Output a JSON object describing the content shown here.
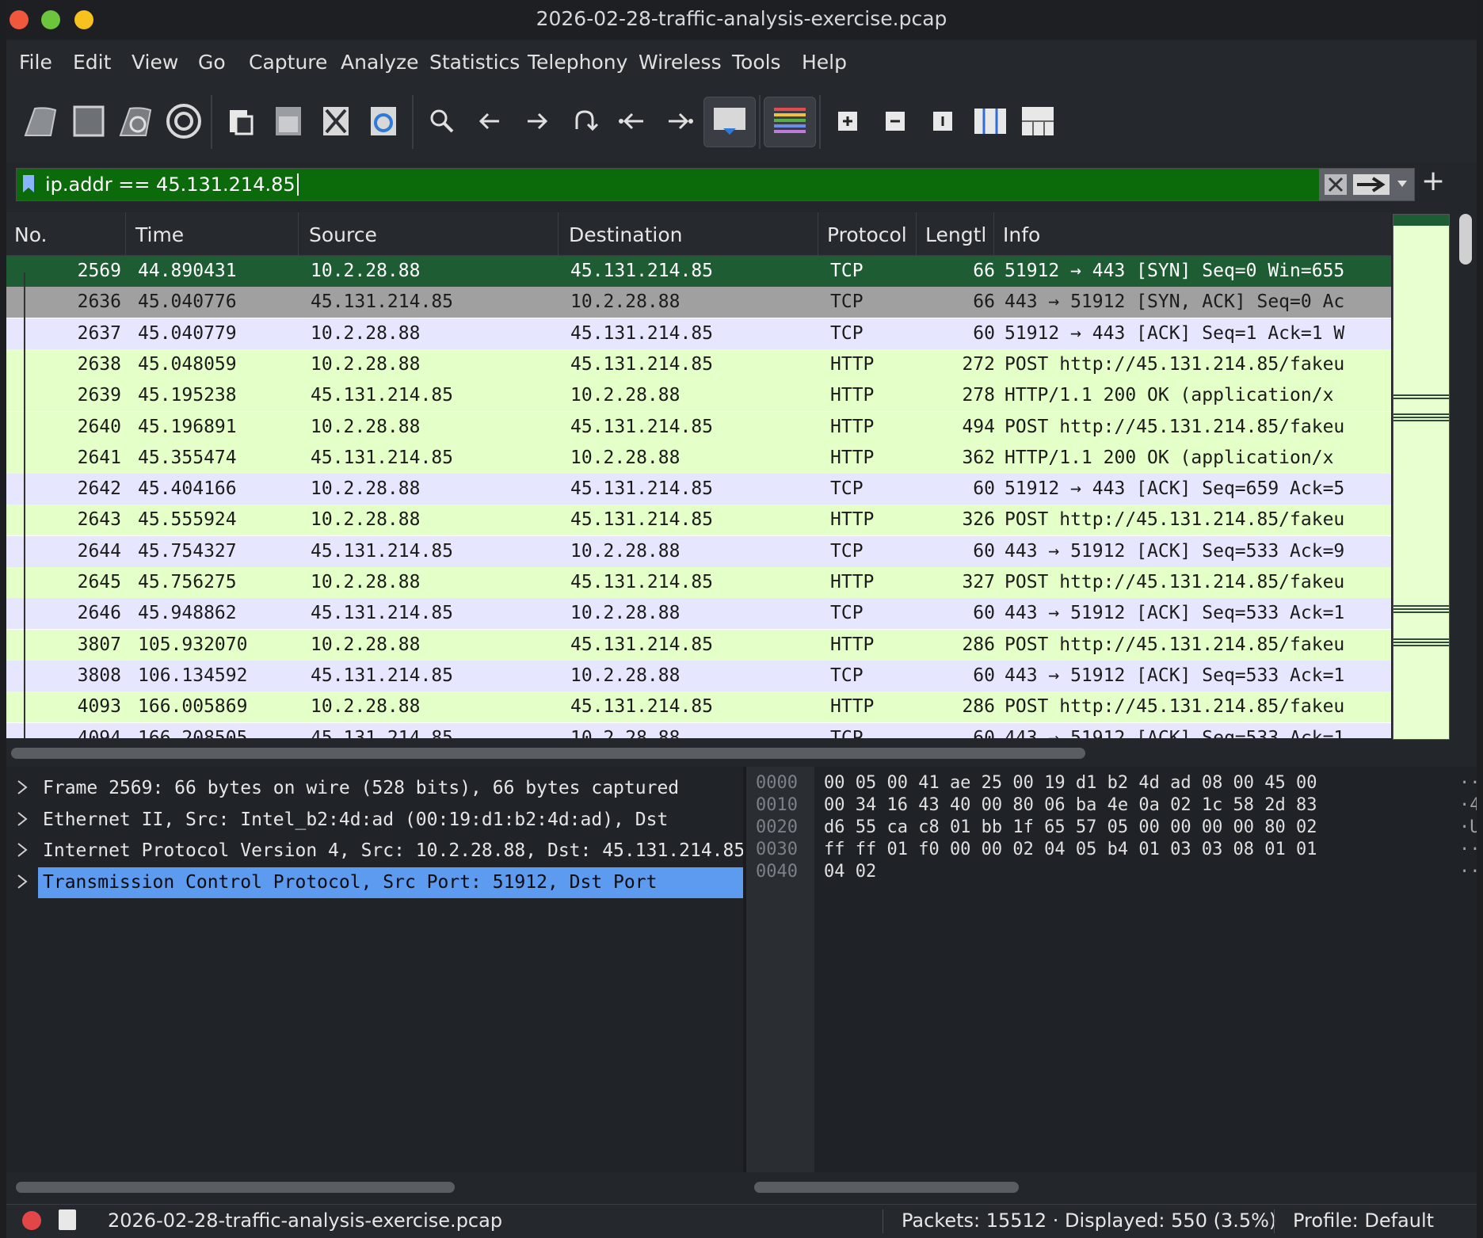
{
  "window": {
    "title": "2026-02-28-traffic-analysis-exercise.pcap"
  },
  "menu": [
    "File",
    "Edit",
    "View",
    "Go",
    "Capture",
    "Analyze",
    "Statistics",
    "Telephony",
    "Wireless",
    "Tools",
    "Help"
  ],
  "toolbar": {
    "icons": [
      "shark-fin-start-icon",
      "stop-square-icon",
      "restart-fin-icon",
      "capture-options-gear-icon",
      "open-file-icon",
      "save-file-icon",
      "close-file-icon",
      "reload-file-icon",
      "find-packet-search-icon",
      "go-back-arrow-icon",
      "go-forward-arrow-icon",
      "go-to-packet-icon",
      "first-packet-icon",
      "last-packet-icon",
      "autoscroll-icon",
      "colorize-icon",
      "zoom-in-icon",
      "zoom-out-icon",
      "normal-size-icon",
      "resize-columns-icon",
      "layout-icon"
    ]
  },
  "filter": {
    "value": "ip.addr == 45.131.214.85",
    "color": "#0b6b0b"
  },
  "packet_list": {
    "columns": [
      "No.",
      "Time",
      "Source",
      "Destination",
      "Protocol",
      "Lengtl",
      "Info"
    ],
    "rows": [
      {
        "no": "2569",
        "time": "44.890431",
        "src": "10.2.28.88",
        "dst": "45.131.214.85",
        "proto": "TCP",
        "len": "66",
        "info": "51912 → 443 [SYN] Seq=0 Win=655",
        "style": "selected"
      },
      {
        "no": "2636",
        "time": "45.040776",
        "src": "45.131.214.85",
        "dst": "10.2.28.88",
        "proto": "TCP",
        "len": "66",
        "info": "443 → 51912 [SYN, ACK] Seq=0 Ac",
        "style": "gray"
      },
      {
        "no": "2637",
        "time": "45.040779",
        "src": "10.2.28.88",
        "dst": "45.131.214.85",
        "proto": "TCP",
        "len": "60",
        "info": "51912 → 443 [ACK] Seq=1 Ack=1 W",
        "style": "tcp"
      },
      {
        "no": "2638",
        "time": "45.048059",
        "src": "10.2.28.88",
        "dst": "45.131.214.85",
        "proto": "HTTP",
        "len": "272",
        "info": "POST http://45.131.214.85/fakeu",
        "style": "http"
      },
      {
        "no": "2639",
        "time": "45.195238",
        "src": "45.131.214.85",
        "dst": "10.2.28.88",
        "proto": "HTTP",
        "len": "278",
        "info": "HTTP/1.1 200 OK  (application/x",
        "style": "http"
      },
      {
        "no": "2640",
        "time": "45.196891",
        "src": "10.2.28.88",
        "dst": "45.131.214.85",
        "proto": "HTTP",
        "len": "494",
        "info": "POST http://45.131.214.85/fakeu",
        "style": "http"
      },
      {
        "no": "2641",
        "time": "45.355474",
        "src": "45.131.214.85",
        "dst": "10.2.28.88",
        "proto": "HTTP",
        "len": "362",
        "info": "HTTP/1.1 200 OK  (application/x",
        "style": "http"
      },
      {
        "no": "2642",
        "time": "45.404166",
        "src": "10.2.28.88",
        "dst": "45.131.214.85",
        "proto": "TCP",
        "len": "60",
        "info": "51912 → 443 [ACK] Seq=659 Ack=5",
        "style": "tcp"
      },
      {
        "no": "2643",
        "time": "45.555924",
        "src": "10.2.28.88",
        "dst": "45.131.214.85",
        "proto": "HTTP",
        "len": "326",
        "info": "POST http://45.131.214.85/fakeu",
        "style": "http"
      },
      {
        "no": "2644",
        "time": "45.754327",
        "src": "45.131.214.85",
        "dst": "10.2.28.88",
        "proto": "TCP",
        "len": "60",
        "info": "443 → 51912 [ACK] Seq=533 Ack=9",
        "style": "tcp"
      },
      {
        "no": "2645",
        "time": "45.756275",
        "src": "10.2.28.88",
        "dst": "45.131.214.85",
        "proto": "HTTP",
        "len": "327",
        "info": "POST http://45.131.214.85/fakeu",
        "style": "http"
      },
      {
        "no": "2646",
        "time": "45.948862",
        "src": "45.131.214.85",
        "dst": "10.2.28.88",
        "proto": "TCP",
        "len": "60",
        "info": "443 → 51912 [ACK] Seq=533 Ack=1",
        "style": "tcp"
      },
      {
        "no": "3807",
        "time": "105.932070",
        "src": "10.2.28.88",
        "dst": "45.131.214.85",
        "proto": "HTTP",
        "len": "286",
        "info": "POST http://45.131.214.85/fakeu",
        "style": "http"
      },
      {
        "no": "3808",
        "time": "106.134592",
        "src": "45.131.214.85",
        "dst": "10.2.28.88",
        "proto": "TCP",
        "len": "60",
        "info": "443 → 51912 [ACK] Seq=533 Ack=1",
        "style": "tcp"
      },
      {
        "no": "4093",
        "time": "166.005869",
        "src": "10.2.28.88",
        "dst": "45.131.214.85",
        "proto": "HTTP",
        "len": "286",
        "info": "POST http://45.131.214.85/fakeu",
        "style": "http"
      },
      {
        "no": "4094",
        "time": "166.208505",
        "src": "45.131.214.85",
        "dst": "10.2.28.88",
        "proto": "TCP",
        "len": "60",
        "info": "443 → 51912 [ACK] Seq=533 Ack=1",
        "style": "tcp"
      }
    ],
    "row_colors": {
      "selected": "#1e5c34",
      "gray": "#a0a0a0",
      "tcp": "#e7e6ff",
      "http": "#e4ffc7"
    }
  },
  "details": [
    {
      "label": "Frame 2569: 66 bytes on wire (528 bits), 66 bytes captured",
      "selected": false
    },
    {
      "label": "Ethernet II, Src: Intel_b2:4d:ad (00:19:d1:b2:4d:ad), Dst",
      "selected": false
    },
    {
      "label": "Internet Protocol Version 4, Src: 10.2.28.88, Dst: 45.131.214.85",
      "selected": false
    },
    {
      "label": "Transmission Control Protocol, Src Port: 51912, Dst Port",
      "selected": true
    }
  ],
  "hex": [
    {
      "off": "0000",
      "bytes": "00 05 00 41 ae 25 00 19  d1 b2 4d ad 08 00 45 00",
      "ascii": "··"
    },
    {
      "off": "0010",
      "bytes": "00 34 16 43 40 00 80 06  ba 4e 0a 02 1c 58 2d 83",
      "ascii": "·4"
    },
    {
      "off": "0020",
      "bytes": "d6 55 ca c8 01 bb 1f 65  57 05 00 00 00 00 80 02",
      "ascii": "·U"
    },
    {
      "off": "0030",
      "bytes": "ff ff 01 f0 00 00 02 04  05 b4 01 03 03 08 01 01",
      "ascii": "··"
    },
    {
      "off": "0040",
      "bytes": "04 02",
      "ascii": "··"
    }
  ],
  "status": {
    "file": "2026-02-28-traffic-analysis-exercise.pcap",
    "packets": "Packets: 15512 · Displayed: 550 (3.5%)",
    "profile": "Profile: Default"
  }
}
